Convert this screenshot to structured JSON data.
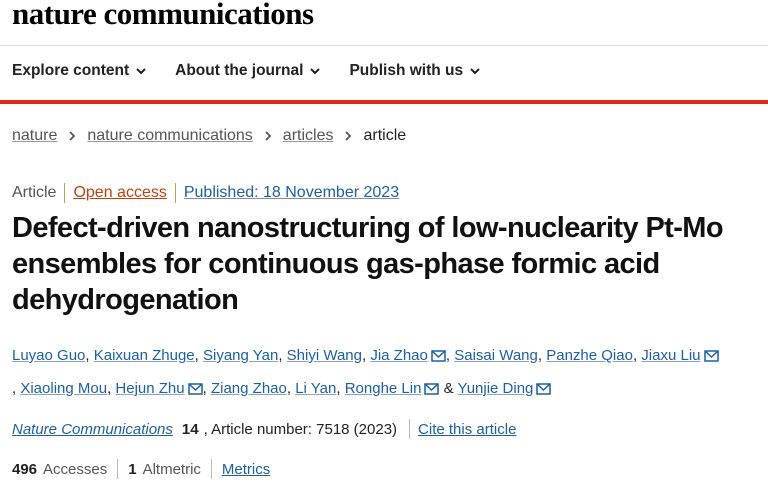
{
  "header": {
    "logo": "nature communications",
    "nav": [
      {
        "label": "Explore content"
      },
      {
        "label": "About the journal"
      },
      {
        "label": "Publish with us"
      }
    ],
    "accent_color": "#e0261b"
  },
  "breadcrumb": {
    "items": [
      "nature",
      "nature communications",
      "articles"
    ],
    "current": "article"
  },
  "article_meta": {
    "type": "Article",
    "access": "Open access",
    "published": "Published: 18 November 2023"
  },
  "article": {
    "title": "Defect-driven nanostructuring of low-nuclearity Pt-Mo ensembles for continuous gas-phase formic acid dehydrogenation",
    "authors": [
      {
        "name": "Luyao Guo",
        "mail": false,
        "after": ", "
      },
      {
        "name": "Kaixuan Zhuge",
        "mail": false,
        "after": ", "
      },
      {
        "name": "Siyang Yan",
        "mail": false,
        "after": ", "
      },
      {
        "name": "Shiyi Wang",
        "mail": false,
        "after": ", "
      },
      {
        "name": "Jia Zhao",
        "mail": true,
        "after": ", "
      },
      {
        "name": "Saisai Wang",
        "mail": false,
        "after": ", "
      },
      {
        "name": "Panzhe Qiao",
        "mail": false,
        "after": ", "
      },
      {
        "name": "Jiaxu Liu",
        "mail": true,
        "after": ", "
      },
      {
        "name": "Xiaoling Mou",
        "mail": false,
        "after": ", "
      },
      {
        "name": "Hejun Zhu",
        "mail": true,
        "after": ", "
      },
      {
        "name": "Ziang Zhao",
        "mail": false,
        "after": ", "
      },
      {
        "name": "Li Yan",
        "mail": false,
        "after": ", "
      },
      {
        "name": "Ronghe Lin",
        "mail": true,
        "after": " & "
      },
      {
        "name": "Yunjie Ding",
        "mail": true,
        "after": ""
      }
    ]
  },
  "citation": {
    "journal": "Nature Communications",
    "volume": "14",
    "article_number": ", Article number: 7518 (2023)",
    "cite_label": "Cite this article"
  },
  "metrics": {
    "accesses_count": "496",
    "accesses_label": "Accesses",
    "altmetric_count": "1",
    "altmetric_label": "Altmetric",
    "metrics_label": "Metrics"
  }
}
